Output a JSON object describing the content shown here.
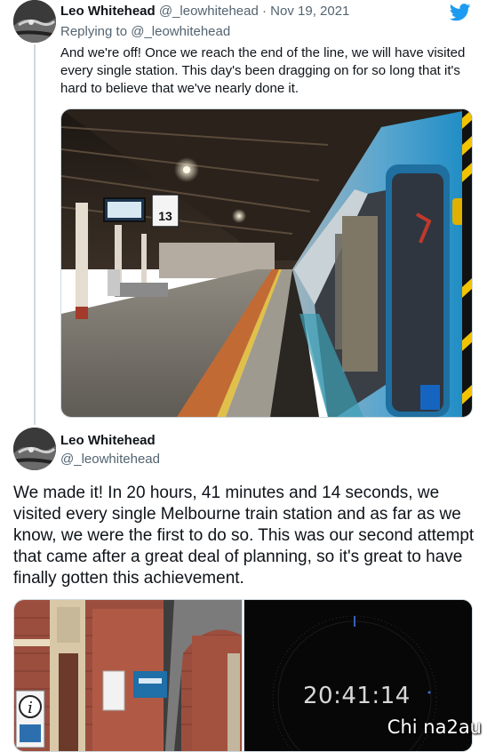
{
  "tweet1": {
    "name": "Leo Whitehead",
    "handle": "@_leowhitehead",
    "separator": "·",
    "date": "Nov 19, 2021",
    "replying_to_prefix": "Replying to",
    "replying_to_handle": "@_leowhitehead",
    "text": "And we're off! Once we reach the end of the line, we will have visited every single station. This day's been dragging on for so long that it's hard to believe that we've nearly done it.",
    "platform_number": "13"
  },
  "tweet2": {
    "name": "Leo Whitehead",
    "handle": "@_leowhitehead",
    "text": "We made it! In 20 hours, 41 minutes and 14 seconds, we visited every single Melbourne train station and as far as we know, we were the first to do so. This was our second attempt that came after a great deal of planning, so it's great to have finally gotten this achievement.",
    "timer": "20:41:14",
    "info_sign": "i"
  },
  "watermark": "Chi na2au",
  "colors": {
    "twitter_blue": "#1d9bf0",
    "text": "#0f1419",
    "muted": "#536471",
    "train_blue": "#1a8bc4"
  },
  "icons": [
    "twitter-bird-icon"
  ]
}
